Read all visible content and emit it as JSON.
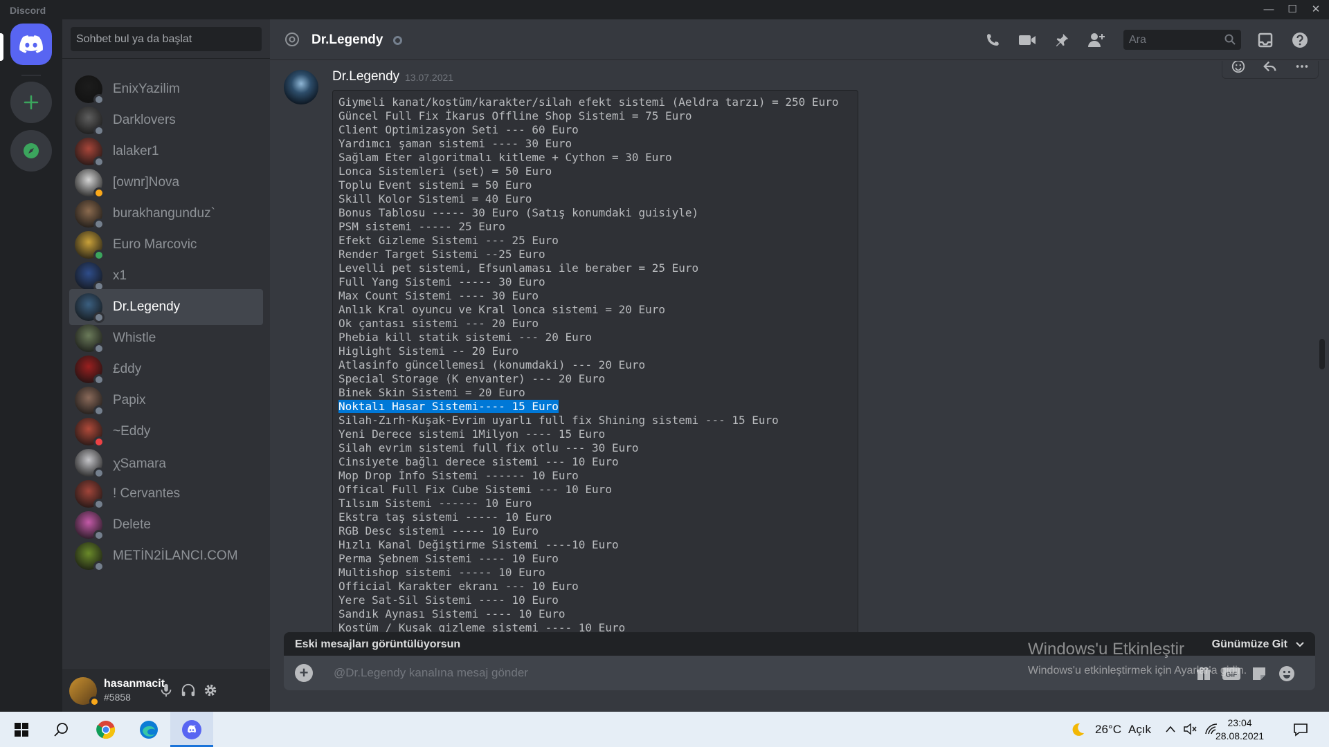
{
  "window": {
    "app_title": "Discord",
    "controls": [
      "minimize-icon",
      "maximize-icon",
      "close-icon"
    ]
  },
  "sidebar": {
    "search_placeholder": "Sohbet bul ya da başlat",
    "dms": [
      {
        "name": "EnixYazilim",
        "status": "offline",
        "avatar_color": "#1c1c1c"
      },
      {
        "name": "Darklovers",
        "status": "offline",
        "avatar_color": "#5e5e5e"
      },
      {
        "name": "lalaker1",
        "status": "offline",
        "avatar_color": "#a8463a"
      },
      {
        "name": "[ownr]Nova",
        "status": "idle",
        "avatar_color": "#d4d4d4"
      },
      {
        "name": "burakhangunduz`",
        "status": "offline",
        "avatar_color": "#8a6a4e"
      },
      {
        "name": "Euro Marcovic",
        "status": "online",
        "avatar_color": "#c9a13a"
      },
      {
        "name": "x1",
        "status": "offline",
        "avatar_color": "#2f4d8a"
      },
      {
        "name": "Dr.Legendy",
        "status": "offline",
        "avatar_color": "#3b5f80",
        "selected": true
      },
      {
        "name": "Whistle",
        "status": "offline",
        "avatar_color": "#6b7b5a"
      },
      {
        "name": "£ddy",
        "status": "offline",
        "avatar_color": "#9a2020"
      },
      {
        "name": "Papix",
        "status": "offline",
        "avatar_color": "#8a6a5a"
      },
      {
        "name": "~Eddy",
        "status": "dnd",
        "avatar_color": "#b04a3a"
      },
      {
        "name": "ꭓSamara",
        "status": "offline",
        "avatar_color": "#c4c4c8"
      },
      {
        "name": "! Cervantes",
        "status": "offline",
        "avatar_color": "#a0453a"
      },
      {
        "name": "Delete",
        "status": "offline",
        "avatar_color": "#c45aa8"
      },
      {
        "name": "METİN2İLANCI.COM",
        "status": "offline",
        "avatar_color": "#6a8a2a"
      }
    ]
  },
  "user_panel": {
    "username": "hasanmacit",
    "tag": "#5858",
    "status": "idle"
  },
  "header": {
    "channel_name": "Dr.Legendy",
    "search_placeholder": "Ara"
  },
  "message": {
    "author": "Dr.Legendy",
    "timestamp": "13.07.2021",
    "selected_line_index": 22,
    "lines": [
      "Giymeli kanat/kostüm/karakter/silah efekt sistemi (Aeldra tarzı) = 250 Euro",
      "Güncel Full Fix İkarus Offline Shop Sistemi = 75 Euro",
      "Client Optimizasyon Seti --- 60 Euro",
      "Yardımcı şaman sistemi ---- 30 Euro",
      "Sağlam Eter algoritmalı kitleme + Cython = 30 Euro",
      "Lonca Sistemleri (set) = 50 Euro",
      "Toplu Event sistemi = 50 Euro",
      "Skill Kolor Sistemi = 40 Euro",
      "Bonus Tablosu ----- 30 Euro (Satış konumdaki guisiyle)",
      "PSM sistemi ----- 25 Euro",
      "Efekt Gizleme Sistemi --- 25 Euro",
      "Render Target Sistemi --25 Euro",
      "Levelli pet sistemi, Efsunlaması ile beraber = 25 Euro",
      "Full Yang Sistemi ----- 30 Euro",
      "Max Count Sistemi ---- 30 Euro",
      "Anlık Kral oyuncu ve Kral lonca sistemi = 20 Euro",
      "Ok çantası sistemi --- 20 Euro",
      "Phebia kill statik sistemi --- 20 Euro",
      "Higlight Sistemi -- 20 Euro",
      "Atlasinfo güncellemesi (konumdaki) --- 20 Euro",
      "Special Storage (K envanter) --- 20 Euro",
      "Binek Skin Sistemi = 20 Euro",
      "Noktalı Hasar Sistemi---- 15 Euro",
      "Silah-Zırh-Kuşak-Evrim uyarlı full fix Shining sistemi --- 15 Euro",
      "Yeni Derece sistemi 1Milyon ---- 15 Euro",
      "Silah evrim sistemi full fix otlu --- 30 Euro",
      "Cinsiyete bağlı derece sistemi --- 10 Euro",
      "Mop Drop İnfo Sistemi ------ 10 Euro",
      "Offical Full Fix Cube Sistemi --- 10 Euro",
      "Tılsım Sistemi ------ 10 Euro",
      "Ekstra taş sistemi ----- 10 Euro",
      "RGB Desc sistemi ----- 10 Euro",
      "Hızlı Kanal Değiştirme Sistemi ----10 Euro",
      "Perma Şebnem Sistemi ---- 10 Euro",
      "Multishop sistemi ----- 10 Euro",
      "Official Karakter ekranı --- 10 Euro",
      "Yere Sat-Sil Sistemi ---- 10 Euro",
      "Sandık Aynası Sistemi ---- 10 Euro",
      "Kostüm / Kuşak gizleme sistemi ---- 10 Euro"
    ]
  },
  "older_messages_bar": {
    "text": "Eski mesajları görüntülüyorsun",
    "jump_label": "Günümüze Git"
  },
  "composer": {
    "placeholder": "@Dr.Legendy kanalına mesaj gönder"
  },
  "windows_activation": {
    "title": "Windows'u Etkinleştir",
    "subtitle": "Windows'u etkinleştirmek için Ayarlar'a gidin."
  },
  "taskbar": {
    "weather_temp": "26°C",
    "weather_desc": "Açık",
    "time": "23:04",
    "date": "28.08.2021"
  },
  "colors": {
    "blurple": "#5865f2",
    "online": "#3ba55d",
    "idle": "#faa81a",
    "dnd": "#ed4245",
    "offline": "#747f8d",
    "green_action": "#3ba55d",
    "selection": "#0078d7"
  }
}
